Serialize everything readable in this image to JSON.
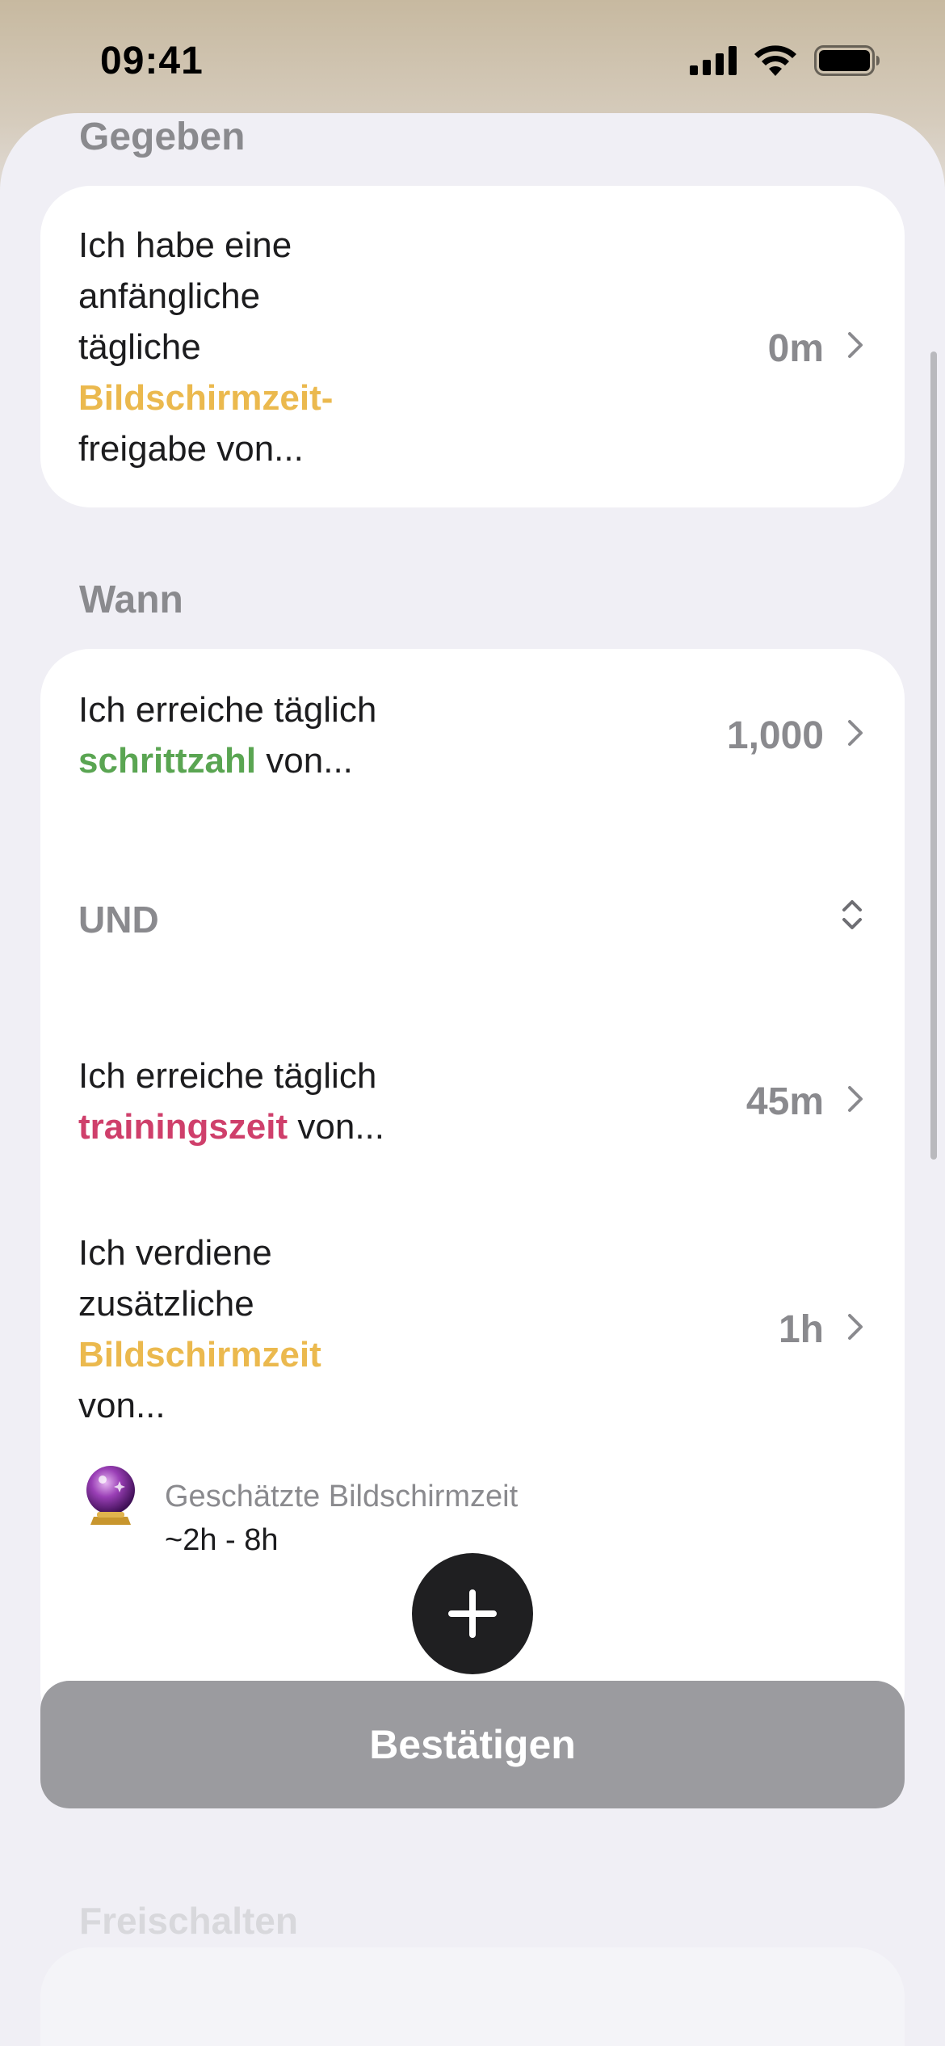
{
  "status_bar": {
    "time": "09:41"
  },
  "sections": {
    "given_title": "Gegeben",
    "when_title": "Wann",
    "hidden_title": "Freischalten"
  },
  "given_card": {
    "line1": "Ich habe eine",
    "line2": "anfängliche",
    "line3": "tägliche",
    "highlight": "Bildschirmzeit-",
    "line5": "freigabe von...",
    "value": "0m",
    "highlight_color": "#EBB94E"
  },
  "when_card": {
    "steps": {
      "prefix": "Ich erreiche täglich",
      "highlight": "schrittzahl",
      "suffix": " von...",
      "value": "1,000",
      "highlight_color": "#5AA552"
    },
    "operator": "UND",
    "training": {
      "prefix": "Ich erreiche täglich",
      "highlight": "trainingszeit",
      "suffix": " von...",
      "value": "45m",
      "highlight_color": "#CF3F6B"
    },
    "extra": {
      "line1": "Ich verdiene",
      "line2": "zusätzliche",
      "highlight": "Bildschirmzeit",
      "line4": "von...",
      "value": "1h"
    },
    "estimate": {
      "label": "Geschätzte Bildschirmzeit",
      "value": "~2h - 8h",
      "icon": "crystal-ball-icon"
    }
  },
  "buttons": {
    "add_icon": "plus-icon",
    "confirm_label": "Bestätigen"
  }
}
